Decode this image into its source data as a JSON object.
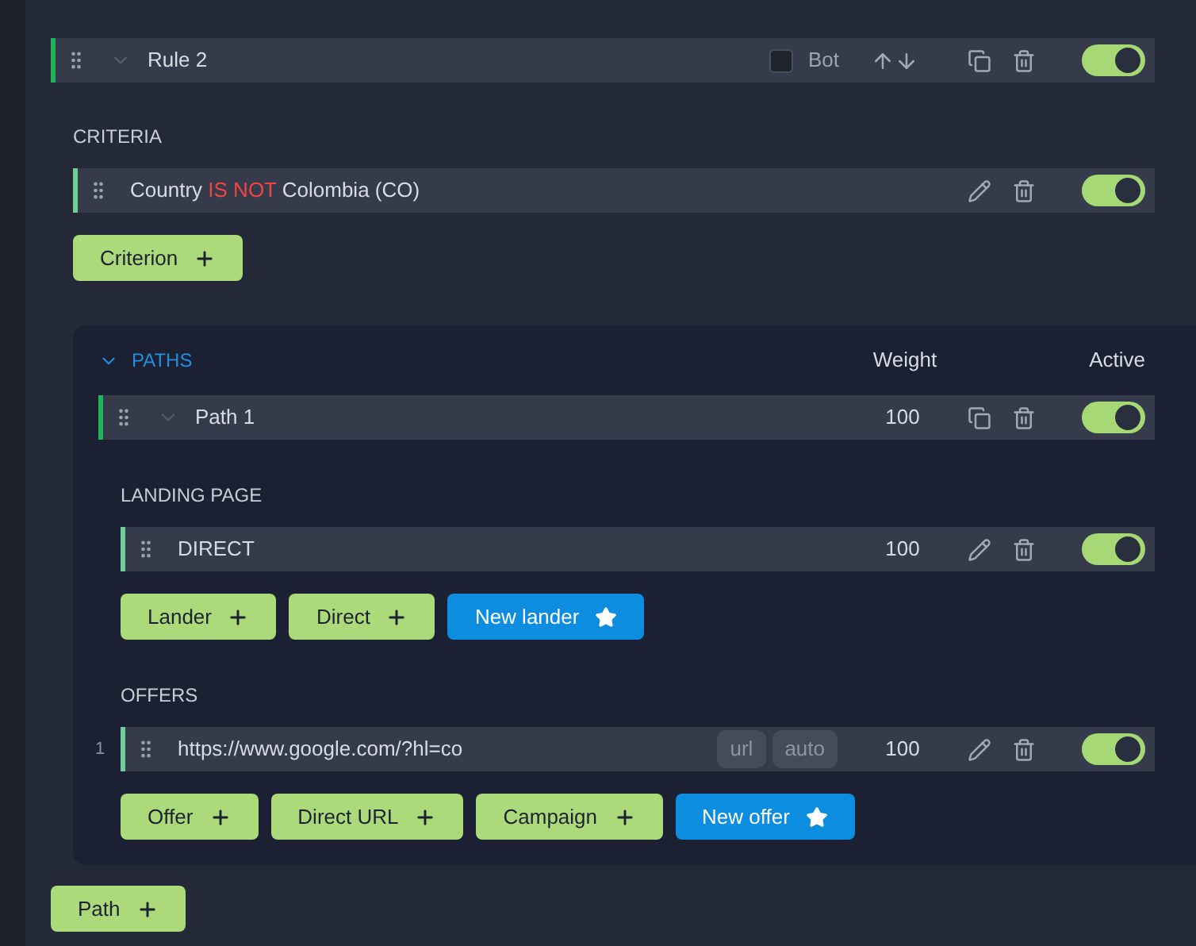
{
  "rule": {
    "name": "Rule 2",
    "bot_label": "Bot",
    "bot_checked": false,
    "active": true
  },
  "criteria_label": "CRITERIA",
  "criteria": [
    {
      "field": "Country",
      "operator": "IS NOT",
      "value": "Colombia (CO)",
      "active": true
    }
  ],
  "criterion_button": "Criterion",
  "paths": {
    "title": "PATHS",
    "expanded": true,
    "weight_header": "Weight",
    "active_header": "Active",
    "items": [
      {
        "name": "Path 1",
        "weight": "100",
        "active": true
      }
    ],
    "landing_label": "LANDING PAGE",
    "landers": [
      {
        "name": "DIRECT",
        "weight": "100",
        "active": true
      }
    ],
    "lander_buttons": [
      {
        "label": "Lander",
        "kind": "add"
      },
      {
        "label": "Direct",
        "kind": "add"
      },
      {
        "label": "New lander",
        "kind": "new"
      }
    ],
    "offers_label": "OFFERS",
    "offers": [
      {
        "index": "1",
        "url": "https://www.google.com/?hl=co",
        "tags": [
          "url",
          "auto"
        ],
        "weight": "100",
        "active": true
      }
    ],
    "offer_buttons": [
      {
        "label": "Offer",
        "kind": "add"
      },
      {
        "label": "Direct URL",
        "kind": "add"
      },
      {
        "label": "Campaign",
        "kind": "add"
      },
      {
        "label": "New offer",
        "kind": "new"
      }
    ]
  },
  "path_button": "Path"
}
